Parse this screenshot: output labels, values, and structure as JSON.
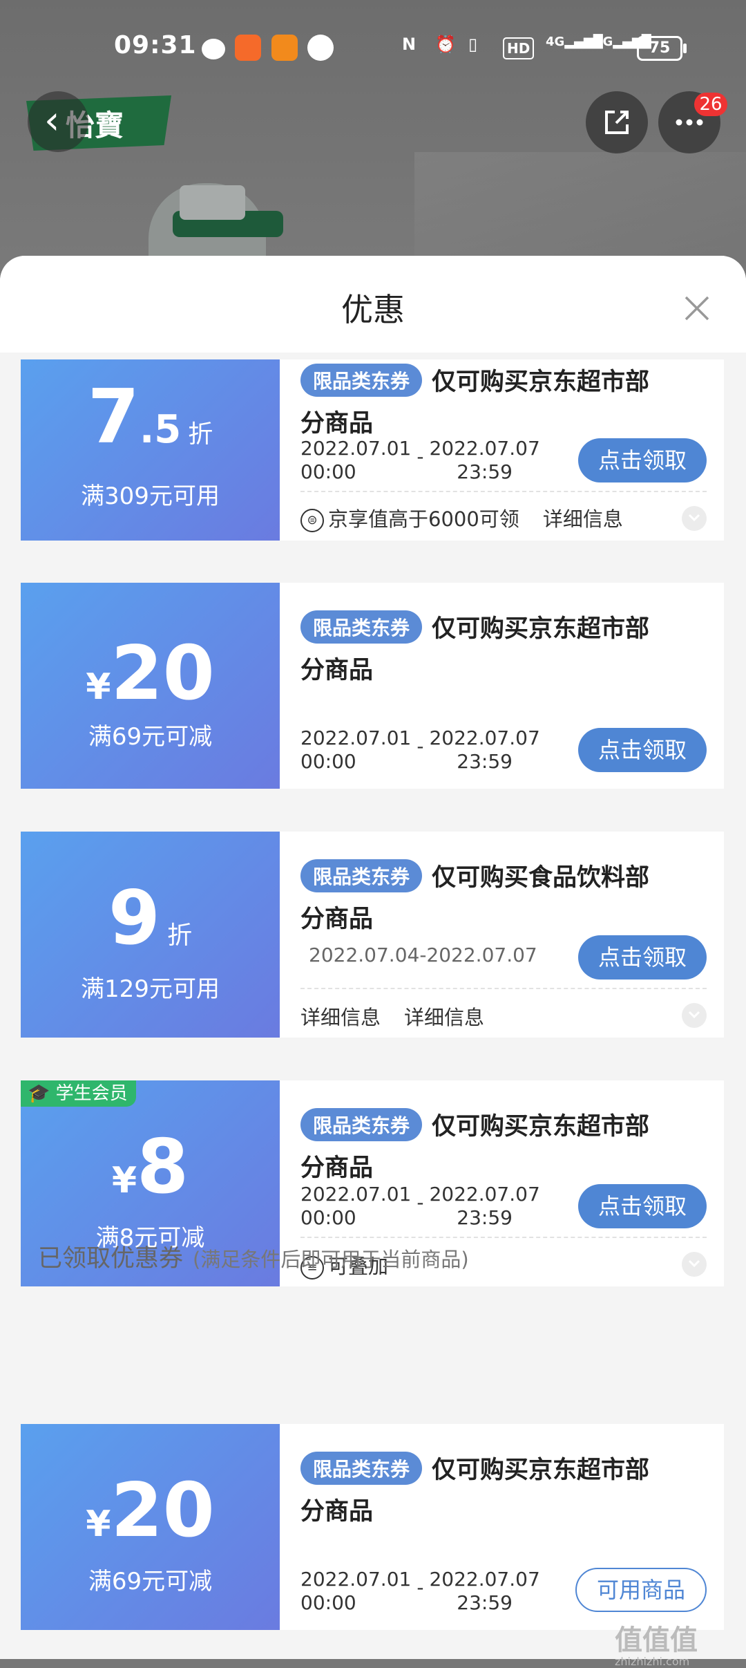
{
  "status_bar": {
    "time": "09:31",
    "battery": "75",
    "net1": "4G",
    "net2": "5G"
  },
  "header": {
    "logo_text": "怡寶",
    "notification_count": "26"
  },
  "sheet": {
    "title": "优惠",
    "coupons": [
      {
        "amount_int": "7",
        "amount_dec": ".5",
        "unit": "折",
        "condition": "满309元可用",
        "tag": "限品类东券",
        "title_line1": "仅可购买京东超市部",
        "title_line2": "分商品",
        "date_start": "2022.07.01",
        "time_start": "00:00",
        "date_end": "2022.07.07",
        "time_end": "23:59",
        "button": "点击领取",
        "footer_1": "京享值高于6000可领",
        "footer_2": "详细信息"
      },
      {
        "amount_symbol": "¥",
        "amount": "20",
        "condition": "满69元可减",
        "tag": "限品类东券",
        "title_line1": "仅可购买京东超市部",
        "title_line2": "分商品",
        "date_start": "2022.07.01",
        "time_start": "00:00",
        "date_end": "2022.07.07",
        "time_end": "23:59",
        "button": "点击领取"
      },
      {
        "amount": "9",
        "unit": "折",
        "condition": "满129元可用",
        "tag": "限品类东券",
        "title_line1": "仅可购买食品饮料部",
        "title_line2": "分商品",
        "date_range": "2022.07.04-2022.07.07",
        "button": "点击领取",
        "footer_1": "详细信息",
        "footer_2": "详细信息"
      },
      {
        "badge": "学生会员",
        "amount_symbol": "¥",
        "amount": "8",
        "condition": "满8元可减",
        "tag": "限品类东券",
        "title_line1": "仅可购买京东超市部",
        "title_line2": "分商品",
        "date_start": "2022.07.01",
        "time_start": "00:00",
        "date_end": "2022.07.07",
        "time_end": "23:59",
        "button": "点击领取",
        "footer_1": "可叠加"
      }
    ],
    "claimed_section": {
      "label": "已领取优惠券",
      "hint": "(满足条件后即可用于当前商品)"
    },
    "claimed_coupons": [
      {
        "amount_symbol": "¥",
        "amount": "20",
        "condition": "满69元可减",
        "tag": "限品类东券",
        "title_line1": "仅可购买京东超市部",
        "title_line2": "分商品",
        "date_start": "2022.07.01",
        "time_start": "00:00",
        "date_end": "2022.07.07",
        "time_end": "23:59",
        "button": "可用商品"
      }
    ]
  },
  "watermark": {
    "main": "值值值",
    "sub": "zhizhizhi.com"
  },
  "colors": {
    "accent": "#4f86d4",
    "coupon_from": "#5aa0ee",
    "coupon_to": "#6a7be0",
    "student_badge": "#2fb66c"
  }
}
